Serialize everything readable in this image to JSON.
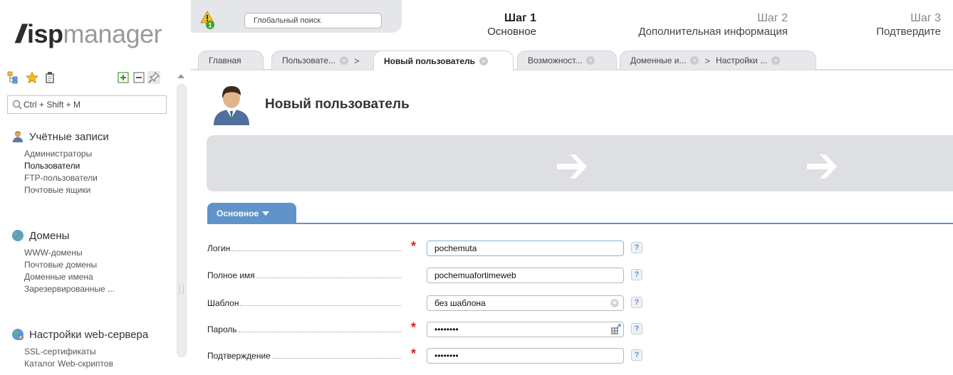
{
  "logo": {
    "slash": "//",
    "isp": "isp",
    "manager": "manager"
  },
  "sidebar": {
    "search_placeholder": "Ctrl + Shift + M",
    "sections": [
      {
        "title": "Учётные записи",
        "icon": "user-accounts-icon",
        "items": [
          "Администраторы",
          "Пользователи",
          "FTP-пользователи",
          "Почтовые ящики"
        ]
      },
      {
        "title": "Домены",
        "icon": "globe-icon",
        "items": [
          "WWW-домены",
          "Почтовые домены",
          "Доменные имена",
          "Зарезервированные ..."
        ]
      },
      {
        "title": "Настройки web-сервера",
        "icon": "web-server-icon",
        "items": [
          "SSL-сертификаты",
          "Каталог Web-скриптов"
        ]
      }
    ],
    "active_item": "Пользователи"
  },
  "topbar": {
    "global_search_placeholder": "Глобальный поиск",
    "warning_count": "1"
  },
  "tabs": {
    "home": "Главная",
    "users": "Пользовате...",
    "new_user": "Новый пользователь",
    "features": "Возможност...",
    "domains": "Доменные и...",
    "settings": "Настройки ...",
    "separator": ">",
    "close": "×"
  },
  "page": {
    "title": "Новый пользователь"
  },
  "wizard": {
    "steps": [
      {
        "number": "Шаг 1",
        "label": "Основное"
      },
      {
        "number": "Шаг 2",
        "label": "Дополнительная информация"
      },
      {
        "number": "Шаг 3",
        "label": "Подтвердите"
      }
    ]
  },
  "form": {
    "tab_label": "Основное",
    "help": "?",
    "required_mark": "*",
    "fields": {
      "login": {
        "label": "Логин",
        "value": "pochemuta"
      },
      "fullname": {
        "label": "Полное имя",
        "value": "pochemuafortimeweb"
      },
      "template": {
        "label": "Шаблон",
        "value": "без шаблона"
      },
      "password": {
        "label": "Пароль",
        "value": "••••••••"
      },
      "confirm": {
        "label": "Подтверждение",
        "value": "••••••••"
      }
    }
  },
  "colors": {
    "accent": "#5f93ca",
    "required": "#e02020",
    "wizard_bg": "#dddfe2"
  }
}
